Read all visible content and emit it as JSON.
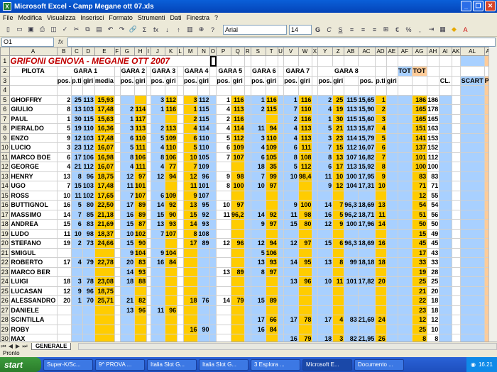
{
  "window": {
    "title": "Microsoft Excel - Camp Megane ott 07.xls"
  },
  "menu": [
    "File",
    "Modifica",
    "Visualizza",
    "Inserisci",
    "Formato",
    "Strumenti",
    "Dati",
    "Finestra",
    "?"
  ],
  "toolbar": {
    "font": "Arial",
    "size": "14",
    "pct": "%",
    "sum": "Σ",
    "fx_label": "fx"
  },
  "namebox": "O1",
  "sheet": {
    "title": "GRIFONI GENOVA - MEGANE OTT 2007",
    "col_letters": [
      "A",
      "B",
      "C",
      "D",
      "E",
      "F",
      "G",
      "H",
      "I",
      "J",
      "K",
      "L",
      "M",
      "N",
      "O",
      "P",
      "Q",
      "R",
      "S",
      "T",
      "U",
      "V",
      "W",
      "X",
      "Y",
      "Z",
      "AB",
      "AC",
      "AD",
      "AE",
      "AF",
      "AG",
      "AH",
      "AI",
      "AK",
      "AL",
      "AM"
    ],
    "header2": {
      "pilota": "PILOTA",
      "g1": "GARA 1",
      "g2": "GARA 2",
      "g3": "GARA 3",
      "g4": "GARA 4",
      "g5": "GARA 5",
      "g6": "GARA 6",
      "g7": "GARA 7",
      "g8": "GARA 8",
      "tot": "TOT",
      "totp": "TOT"
    },
    "header3": {
      "pos": "pos.",
      "pti": "p.ti",
      "giri": "giri",
      "media": "media",
      "cl": "CL.",
      "scart": "SCART",
      "ptot": "P.TI"
    },
    "rows": [
      [
        "5",
        "GHOFFRY",
        "2",
        "25",
        "113",
        "15,93",
        "",
        "",
        "3",
        "112",
        "3",
        "112",
        "1",
        "116",
        "1",
        "116",
        "1",
        "116",
        "2",
        "25",
        "115",
        "15,65",
        "1",
        "186",
        "186"
      ],
      [
        "6",
        "GIULIO",
        "8",
        "13",
        "103",
        "17,48",
        "2",
        "114",
        "1",
        "116",
        "1",
        "115",
        "4",
        "113",
        "2",
        "115",
        "7",
        "110",
        "4",
        "19",
        "113",
        "15,90",
        "2",
        "165",
        "178"
      ],
      [
        "7",
        "PAUL",
        "1",
        "30",
        "115",
        "15,63",
        "1",
        "117",
        "",
        "",
        "2",
        "115",
        "2",
        "116",
        "",
        "",
        "2",
        "116",
        "1",
        "30",
        "115",
        "15,60",
        "3",
        "165",
        "165"
      ],
      [
        "8",
        "PIERALDO",
        "5",
        "19",
        "110",
        "16,36",
        "3",
        "113",
        "2",
        "113",
        "4",
        "114",
        "4",
        "114",
        "11",
        "94",
        "4",
        "113",
        "5",
        "21",
        "113",
        "15,87",
        "4",
        "151",
        "163"
      ],
      [
        "9",
        "ENZO",
        "9",
        "12",
        "103",
        "17,48",
        "6",
        "110",
        "5",
        "109",
        "6",
        "110",
        "5",
        "112",
        "3",
        "110",
        "4",
        "113",
        "3",
        "23",
        "114",
        "15,79",
        "5",
        "141",
        "153"
      ],
      [
        "10",
        "LUCIO",
        "3",
        "23",
        "112",
        "16,07",
        "5",
        "111",
        "4",
        "110",
        "5",
        "110",
        "6",
        "109",
        "4",
        "109",
        "6",
        "111",
        "7",
        "15",
        "112",
        "16,07",
        "6",
        "137",
        "152"
      ],
      [
        "11",
        "MARCO BOE",
        "6",
        "17",
        "106",
        "16,98",
        "8",
        "106",
        "8",
        "106",
        "10",
        "105",
        "7",
        "107",
        "6",
        "105",
        "8",
        "108",
        "8",
        "13",
        "107",
        "16,82",
        "7",
        "101",
        "112"
      ],
      [
        "12",
        "GEORGE",
        "4",
        "21",
        "112",
        "16,07",
        "4",
        "111",
        "4",
        "77",
        "7",
        "109",
        "",
        "",
        "18",
        "35",
        "5",
        "112",
        "6",
        "17",
        "113",
        "15,92",
        "8",
        "100",
        "100"
      ],
      [
        "13",
        "HENRY",
        "13",
        "8",
        "96",
        "18,75",
        "12",
        "97",
        "12",
        "94",
        "12",
        "96",
        "9",
        "98",
        "7",
        "99",
        "10",
        "98,4",
        "11",
        "10",
        "100",
        "17,95",
        "9",
        "83",
        "83"
      ],
      [
        "14",
        "UGO",
        "7",
        "15",
        "103",
        "17,48",
        "11",
        "101",
        "",
        "",
        "11",
        "101",
        "8",
        "100",
        "10",
        "97",
        "",
        "",
        "9",
        "12",
        "104",
        "17,31",
        "10",
        "71",
        "71"
      ],
      [
        "15",
        "ROSS",
        "10",
        "11",
        "102",
        "17,65",
        "7",
        "107",
        "6",
        "109",
        "9",
        "107",
        "",
        "",
        "",
        "",
        "",
        "",
        "",
        "",
        "",
        "",
        "",
        "12",
        "55"
      ],
      [
        "16",
        "BUTTIGNOL",
        "16",
        "5",
        "80",
        "22,50",
        "17",
        "89",
        "14",
        "92",
        "13",
        "95",
        "10",
        "97",
        "",
        "",
        "9",
        "100",
        "14",
        "7",
        "96,3",
        "18,69",
        "13",
        "54",
        "54"
      ],
      [
        "17",
        "MASSIMO",
        "14",
        "7",
        "85",
        "21,18",
        "16",
        "89",
        "15",
        "90",
        "15",
        "92",
        "11",
        "96,2",
        "14",
        "92",
        "11",
        "98",
        "16",
        "5",
        "96,2",
        "18,71",
        "11",
        "51",
        "56"
      ],
      [
        "18",
        "ANDREA",
        "15",
        "6",
        "83",
        "21,69",
        "15",
        "87",
        "13",
        "93",
        "14",
        "93",
        "",
        "",
        "9",
        "97",
        "15",
        "80",
        "12",
        "9",
        "100",
        "17,96",
        "14",
        "50",
        "50"
      ],
      [
        "19",
        "LUDO",
        "11",
        "10",
        "98",
        "18,37",
        "10",
        "102",
        "7",
        "107",
        "8",
        "108",
        "",
        "",
        "",
        "",
        "",
        "",
        "",
        "",
        "",
        "",
        "",
        "15",
        "49"
      ],
      [
        "20",
        "STEFANO",
        "19",
        "2",
        "73",
        "24,66",
        "15",
        "90",
        "",
        "",
        "17",
        "89",
        "12",
        "96",
        "12",
        "94",
        "12",
        "97",
        "15",
        "6",
        "96,3",
        "18,69",
        "16",
        "45",
        "45"
      ],
      [
        "21",
        "SMIGUL",
        "",
        "",
        "",
        "",
        "9",
        "104",
        "9",
        "104",
        "",
        "",
        "",
        "",
        "5",
        "106",
        "",
        "",
        "",
        "",
        "",
        "",
        "",
        "17",
        "43"
      ],
      [
        "22",
        "ROBERTO",
        "17",
        "4",
        "79",
        "22,78",
        "20",
        "83",
        "16",
        "84",
        "",
        "",
        "",
        "",
        "13",
        "93",
        "14",
        "95",
        "13",
        "8",
        "99",
        "18,18",
        "18",
        "33",
        "33"
      ],
      [
        "23",
        "MARCO BER",
        "",
        "",
        "",
        "",
        "14",
        "93",
        "",
        "",
        "",
        "",
        "13",
        "89",
        "8",
        "97",
        "",
        "",
        "",
        "",
        "",
        "",
        "",
        "19",
        "28"
      ],
      [
        "24",
        "LUIGI",
        "18",
        "3",
        "78",
        "23,08",
        "18",
        "88",
        "",
        "",
        "",
        "",
        "",
        "",
        "",
        "",
        "13",
        "96",
        "10",
        "11",
        "101",
        "17,82",
        "20",
        "25",
        "25"
      ],
      [
        "25",
        "LUCASAN",
        "12",
        "9",
        "96",
        "18,75",
        "",
        "",
        "",
        "",
        "",
        "",
        "",
        "",
        "",
        "",
        "",
        "",
        "",
        "",
        "",
        "",
        "",
        "21",
        "20"
      ],
      [
        "26",
        "ALESSANDRO",
        "20",
        "1",
        "70",
        "25,71",
        "21",
        "82",
        "",
        "",
        "18",
        "76",
        "14",
        "79",
        "15",
        "89",
        "",
        "",
        "",
        "",
        "",
        "",
        "",
        "22",
        "18"
      ],
      [
        "27",
        "DANIELE",
        "",
        "",
        "",
        "",
        "13",
        "96",
        "11",
        "96",
        "",
        "",
        "",
        "",
        "",
        "",
        "",
        "",
        "",
        "",
        "",
        "",
        "",
        "23",
        "18"
      ],
      [
        "28",
        "SCINTILLA",
        "",
        "",
        "",
        "",
        "",
        "",
        "",
        "",
        "",
        "",
        "",
        "",
        "17",
        "66",
        "17",
        "78",
        "17",
        "4",
        "83",
        "21,69",
        "24",
        "12",
        "12"
      ],
      [
        "29",
        "ROBY",
        "",
        "",
        "",
        "",
        "",
        "",
        "",
        "",
        "16",
        "90",
        "",
        "",
        "16",
        "84",
        "",
        "",
        "",
        "",
        "",
        "",
        "",
        "25",
        "10"
      ],
      [
        "30",
        "MAX",
        "",
        "",
        "",
        "",
        "",
        "",
        "",
        "",
        "",
        "",
        "",
        "",
        "",
        "",
        "16",
        "79",
        "18",
        "3",
        "82",
        "21,95",
        "26",
        "8",
        "8"
      ]
    ]
  },
  "sheet_tab": "GENERALE",
  "status": "Pronto",
  "taskbar": {
    "start": "start",
    "tasks": [
      "Super-K/Sc...",
      "9^ PROVA ...",
      "Italia Slot G...",
      "Italia Slot G...",
      "3 Esplora ...",
      "Microsoft E...",
      "Documento ..."
    ],
    "clock": "16.21"
  }
}
